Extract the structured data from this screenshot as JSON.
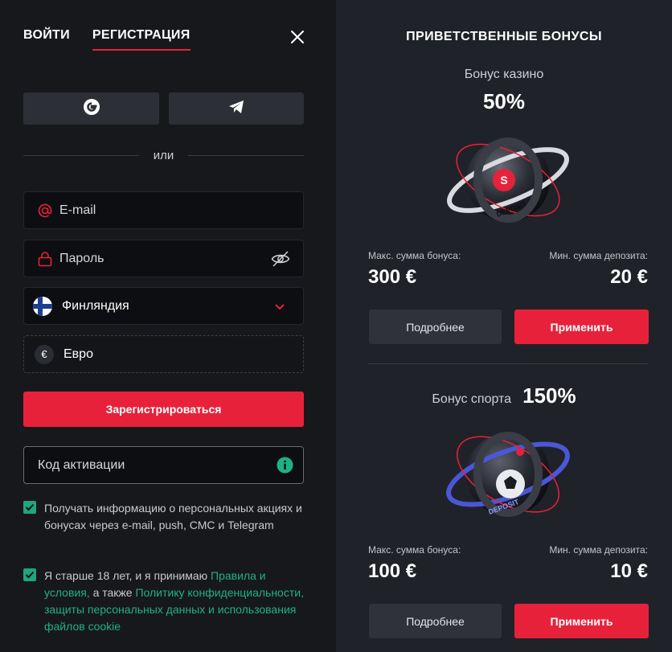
{
  "auth": {
    "tabs": [
      "ВОЙТИ",
      "РЕГИСТРАЦИЯ"
    ],
    "active_tab": "РЕГИСТРАЦИЯ",
    "divider_text": "или",
    "fields": {
      "email": "E-mail",
      "password": "Пароль",
      "country": "Финляндия",
      "currency": "Евро"
    },
    "register_button": "Зарегистрироваться",
    "promo_placeholder": "Код активации",
    "consent_marketing": "Получать информацию о персональных акциях и бонусах через e-mail, push, СМС и Telegram",
    "consent_age_prefix": "Я старше 18 лет, и я принимаю ",
    "consent_terms_link": "Правила и условия,",
    "consent_middle": " а также ",
    "consent_privacy_link": "Политику конфиденциальности, защиты персональных данных и использования файлов cookie",
    "icons": [
      "google-icon",
      "telegram-icon",
      "email-icon",
      "lock-icon",
      "eye-off-icon",
      "finland-flag-icon",
      "chevron-down-icon",
      "euro-icon",
      "info-icon",
      "close-icon",
      "checkbox-check-icon"
    ]
  },
  "bonuses": {
    "heading": "ПРИВЕТСТВЕННЫЕ БОНУСЫ",
    "casino": {
      "name": "Бонус казино",
      "percent": "50%",
      "max_label": "Макс. сумма бонуса:",
      "max_value": "300 €",
      "min_label": "Мин. сумма депозита:",
      "min_value": "20 €",
      "details_button": "Подробнее",
      "apply_button": "Применить"
    },
    "sport": {
      "name": "Бонус спорта",
      "percent": "150%",
      "max_label": "Макс. сумма бонуса:",
      "max_value": "100 €",
      "min_label": "Мин. сумма депозита:",
      "min_value": "10 €",
      "details_button": "Подробнее",
      "apply_button": "Применить"
    },
    "image_text": "DEPOSIT"
  },
  "colors": {
    "accent_red": "#e8213a",
    "accent_green": "#1fa67a",
    "left_bg": "#17181c",
    "right_bg": "#202229"
  }
}
